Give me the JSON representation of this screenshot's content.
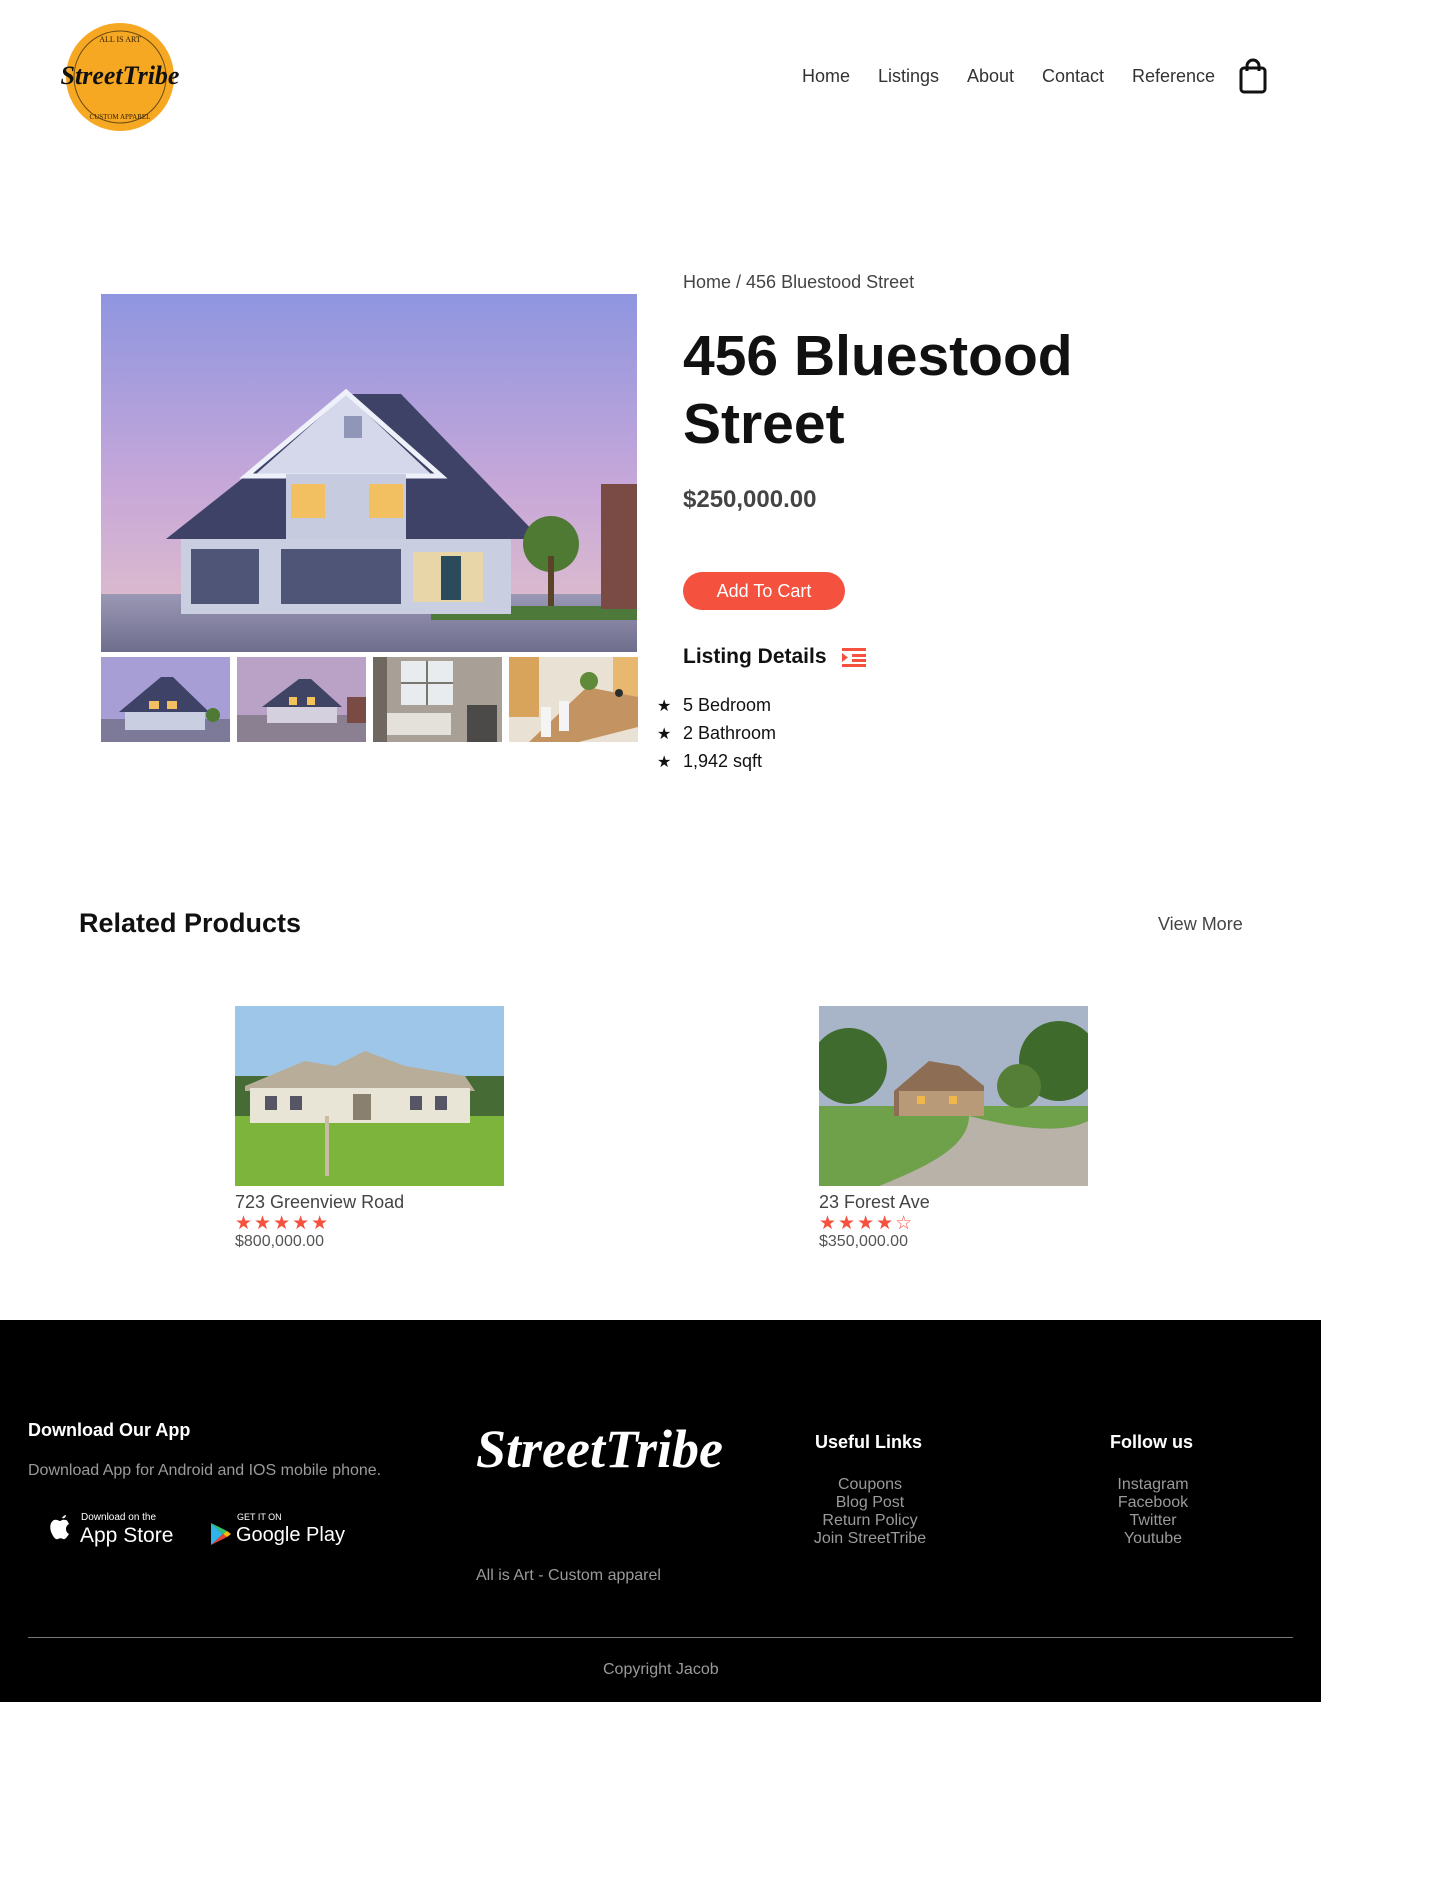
{
  "header": {
    "logo": {
      "text": "StreetTribe",
      "ring_top": "ALL IS ART",
      "ring_bottom": "CUSTOM APPAREL"
    },
    "nav": [
      "Home",
      "Listings",
      "About",
      "Contact",
      "Reference"
    ],
    "cart_icon": "shopping-bag-icon"
  },
  "product": {
    "breadcrumb": {
      "home": "Home",
      "separator": " / ",
      "current": "456 Bluestood Street"
    },
    "title": "456 Bluestood Street",
    "price": "$250,000.00",
    "add_to_cart": "Add To Cart",
    "details_title": "Listing Details",
    "details_icon": "list-indent-icon",
    "details": [
      "5 Bedroom",
      "2 Bathroom",
      "1,942 sqft"
    ],
    "detail_bullet": "★"
  },
  "related": {
    "title": "Related Products",
    "view_more": "View More",
    "items": [
      {
        "name": "723 Greenview Road",
        "stars": "★★★★★",
        "rating": 5,
        "price": "$800,000.00"
      },
      {
        "name": "23 Forest Ave",
        "stars": "★★★★☆",
        "rating": 4,
        "price": "$350,000.00"
      }
    ]
  },
  "footer": {
    "app_title": "Download Our App",
    "app_text": "Download App for Android and IOS mobile phone.",
    "app_store": {
      "small": "Download on the",
      "big": "App Store"
    },
    "google_play": {
      "small": "GET IT ON",
      "big": "Google Play"
    },
    "brand": "StreetTribe",
    "tagline": "All is Art - Custom apparel",
    "useful_title": "Useful Links",
    "useful_links": [
      "Coupons",
      "Blog Post",
      "Return Policy",
      "Join StreetTribe"
    ],
    "follow_title": "Follow us",
    "follow_links": [
      "Instagram",
      "Facebook",
      "Twitter",
      "Youtube"
    ],
    "copyright": "Copyright Jacob"
  },
  "colors": {
    "accent": "#f5513f",
    "logo_yellow": "#f7a823",
    "footer_bg": "#000000"
  }
}
